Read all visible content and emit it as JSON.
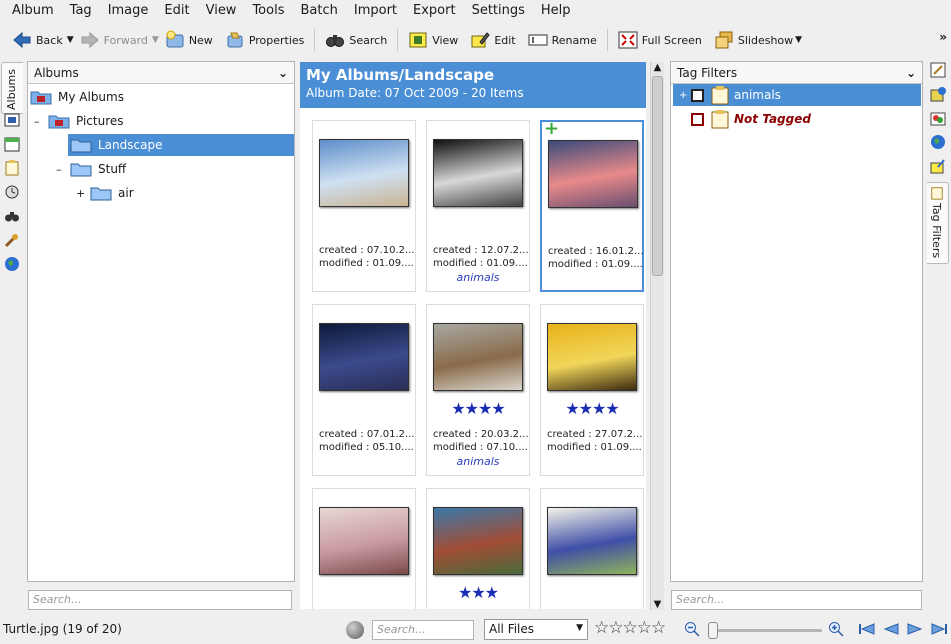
{
  "menubar": [
    "Album",
    "Tag",
    "Image",
    "Edit",
    "View",
    "Tools",
    "Batch",
    "Import",
    "Export",
    "Settings",
    "Help"
  ],
  "toolbar": {
    "back": "Back",
    "forward": "Forward",
    "new": "New",
    "properties": "Properties",
    "search": "Search",
    "view": "View",
    "edit": "Edit",
    "rename": "Rename",
    "fullscreen": "Full Screen",
    "slideshow": "Slideshow",
    "overflow": "»"
  },
  "left_strip": {
    "active_tab": "Albums"
  },
  "albums_panel": {
    "combo": "Albums",
    "tree": [
      {
        "label": "My Albums",
        "expander": ""
      },
      {
        "label": "Pictures",
        "expander": "–"
      },
      {
        "label": "Landscape",
        "expander": ""
      },
      {
        "label": "Stuff",
        "expander": "–"
      },
      {
        "label": "air",
        "expander": "+"
      }
    ],
    "search_placeholder": "Search..."
  },
  "center": {
    "title": "My Albums/Landscape",
    "subtitle": "Album Date: 07 Oct 2009 - 20 Items",
    "thumbs": [
      {
        "created": "created : 07.10.2...",
        "modified": "modified : 01.09....",
        "tag": "",
        "rating": 0,
        "colors": [
          "#5d8ec9",
          "#cfe0f2",
          "#c9b493"
        ]
      },
      {
        "created": "created : 12.07.2...",
        "modified": "modified : 01.09....",
        "tag": "animals",
        "rating": 0,
        "colors": [
          "#0f0f0f",
          "#d8d8d8",
          "#444444"
        ]
      },
      {
        "created": "created : 16.01.2...",
        "modified": "modified : 01.09....",
        "tag": "",
        "rating": 0,
        "colors": [
          "#3a4a7a",
          "#e88a8a",
          "#6a4e70"
        ]
      },
      {
        "created": "created : 07.01.2...",
        "modified": "modified : 05.10....",
        "tag": "",
        "rating": 0,
        "colors": [
          "#0d1a3a",
          "#3b4a8c",
          "#2a2e55"
        ]
      },
      {
        "created": "created : 20.03.2...",
        "modified": "modified : 07.10....",
        "tag": "animals",
        "rating": 4,
        "colors": [
          "#a8a8a2",
          "#8a6b4a",
          "#d9d5cc"
        ]
      },
      {
        "created": "created : 27.07.2...",
        "modified": "modified : 01.09....",
        "tag": "",
        "rating": 4,
        "colors": [
          "#e8b21a",
          "#f1d65a",
          "#3d2b10"
        ]
      },
      {
        "created": "",
        "modified": "",
        "tag": "",
        "rating": 0,
        "colors": [
          "#e7d7d2",
          "#c99aa2",
          "#7a4a4a"
        ]
      },
      {
        "created": "",
        "modified": "",
        "tag": "",
        "rating": 3,
        "colors": [
          "#3b78a8",
          "#a24d35",
          "#4a6a3a"
        ]
      },
      {
        "created": "",
        "modified": "",
        "tag": "",
        "rating": 0,
        "colors": [
          "#f4f4e8",
          "#3f4fa8",
          "#8fb35a"
        ]
      }
    ]
  },
  "tag_panel": {
    "combo": "Tag Filters",
    "items": [
      {
        "label": "animals",
        "expander": "+"
      },
      {
        "label": "Not Tagged",
        "expander": ""
      }
    ],
    "search_placeholder": "Search...",
    "side_tab": "Tag Filters"
  },
  "statusbar": {
    "file": "Turtle.jpg (19 of 20)",
    "search_placeholder": "Search...",
    "filter": "All Files",
    "rating": "☆☆☆☆☆",
    "zoom_position": 0.0
  },
  "colors": {
    "accent": "#4a8fd6",
    "star": "#1c2fb4",
    "tag_text": "#2b3fbd",
    "not_tagged": "#8b0000"
  }
}
